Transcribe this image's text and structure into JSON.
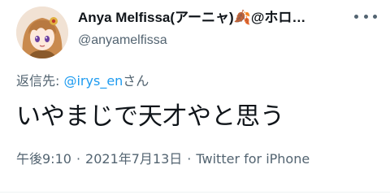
{
  "author": {
    "display_name": "Anya Melfissa(アーニャ)🍂@ホロ…",
    "handle": "@anyamelfissa"
  },
  "reply": {
    "prefix": "返信先: ",
    "mention": "@irys_en",
    "suffix": "さん"
  },
  "tweet": {
    "text": "いやまじで天才やと思う"
  },
  "meta": {
    "time": "午後9:10",
    "separator": "·",
    "date": "2021年7月13日",
    "source": "Twitter for iPhone"
  },
  "colors": {
    "text": "#0f1419",
    "secondary": "#536471",
    "link": "#1d9bf0",
    "background": "#ffffff"
  },
  "icons": {
    "more": "more-dots-icon",
    "avatar": "avatar-illustration"
  }
}
